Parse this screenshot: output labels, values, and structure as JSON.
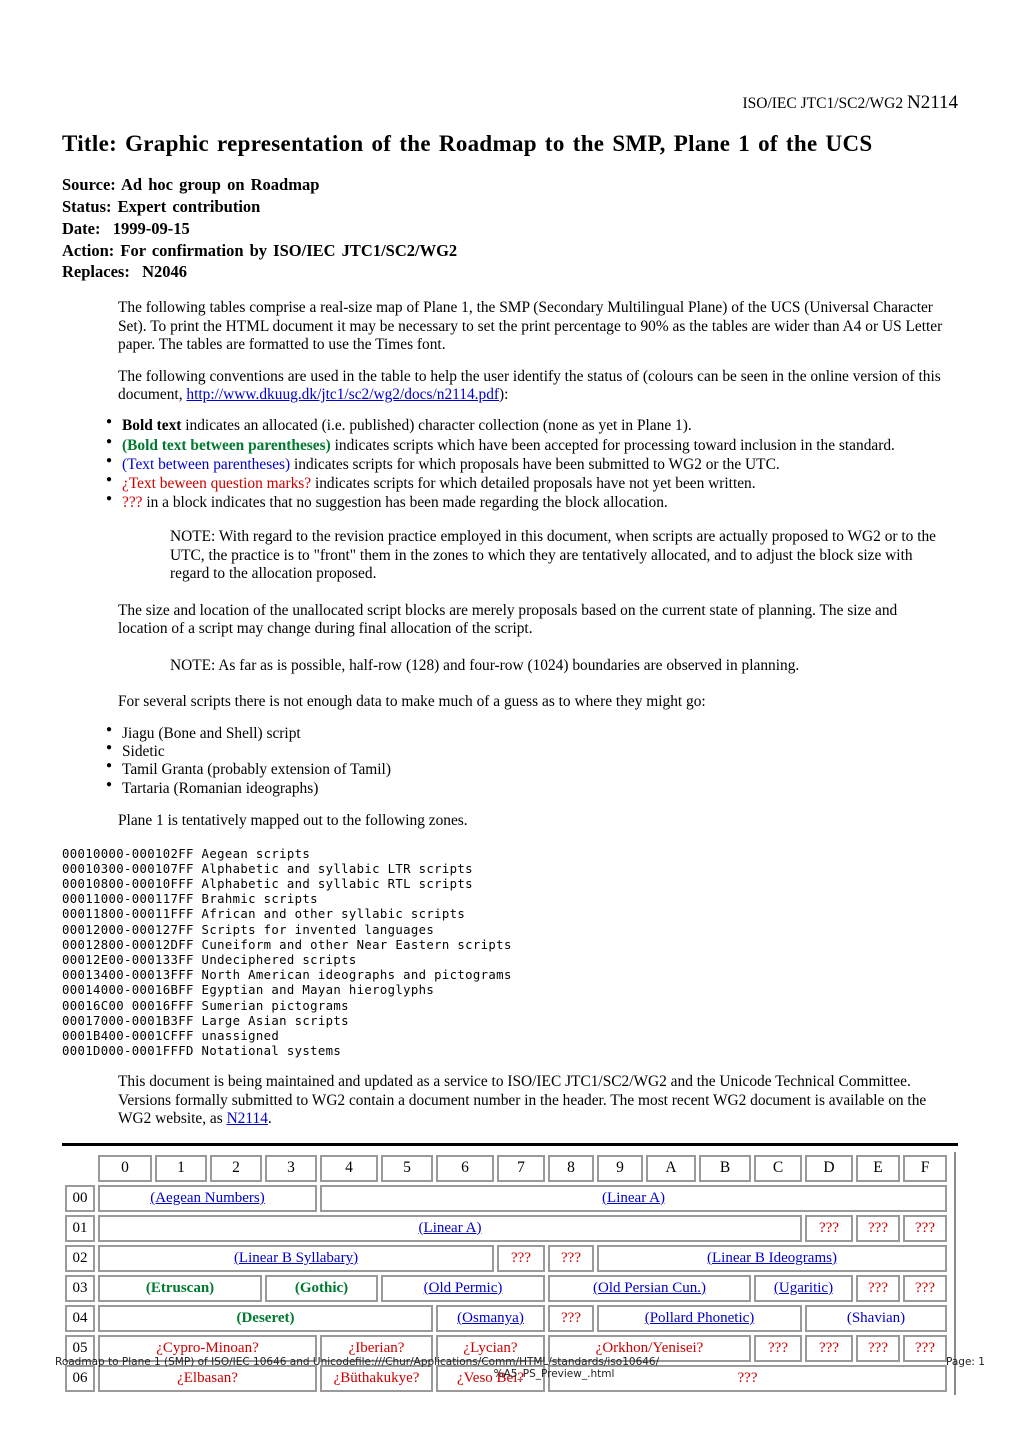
{
  "header": {
    "prefix": "ISO/IEC JTC1/SC2/WG2 ",
    "number": "N2114"
  },
  "title": "Title: Graphic representation of the Roadmap to the SMP, Plane 1 of the UCS",
  "meta": {
    "source": "Source: Ad hoc group on Roadmap",
    "status": "Status: Expert contribution",
    "date": "Date:  1999-09-15",
    "action": "Action: For confirmation by ISO/IEC JTC1/SC2/WG2",
    "replaces": "Replaces:  N2046"
  },
  "paragraphs": {
    "intro": "The following tables comprise a real-size map of Plane 1, the SMP (Secondary Multilingual Plane) of the UCS (Universal Character Set). To print the HTML document it may be necessary to set the print percentage to 90% as the tables are wider than A4 or US Letter paper. The tables are formatted to use the Times font.",
    "conventions_lead_1": "The following conventions are used in the table to help the user identify the status of (colours can be seen in the online version of this document, ",
    "conventions_link": "http://www.dkuug.dk/jtc1/sc2/wg2/docs/n2114.pdf",
    "conventions_lead_2": "):",
    "note_revision": "NOTE: With regard to the revision practice employed in this document, when scripts are actually proposed to WG2 or to the UTC, the practice is to \"front\" them in the zones to which they are tentatively allocated, and to adjust the block size with regard to the allocation proposed.",
    "size_location": "The size and location of the unallocated script blocks are merely proposals based on the current state of planning. The size and location of a script may change during final allocation of the script.",
    "note_boundaries": "NOTE: As far as is possible, half-row (128) and four-row (1024) boundaries are observed in planning.",
    "several_scripts": "For several scripts there is not enough data to make much of a guess as to where they might go:",
    "plane_zones_lead": "Plane 1 is tentatively mapped out to the following zones.",
    "maintained_1": "This document is being maintained and updated as a service to ISO/IEC JTC1/SC2/WG2 and the Unicode Technical Committee. Versions formally submitted to WG2 contain a document number in the header. The most recent WG2 document is available on the WG2 website, as ",
    "maintained_link": "N2114",
    "maintained_2": "."
  },
  "conventions": [
    {
      "marker": "Bold text",
      "marker_style": "bold",
      "text": " indicates an allocated (i.e. published) character collection (none as yet in Plane 1)."
    },
    {
      "marker": "(Bold text between parentheses)",
      "marker_style": "green",
      "text": " indicates scripts which have been accepted for processing toward inclusion in the standard."
    },
    {
      "marker": "(Text between parentheses)",
      "marker_style": "blue",
      "text": " indicates scripts for which proposals have been submitted to WG2 or the UTC."
    },
    {
      "marker": "¿Text beween question marks?",
      "marker_style": "red",
      "text": " indicates scripts for which detailed proposals have not yet been written."
    },
    {
      "marker": "???",
      "marker_style": "red",
      "text": " in a block indicates that no suggestion has been made regarding the block allocation."
    }
  ],
  "unplaced_scripts": [
    "Jiagu (Bone and Shell) script",
    "Sidetic",
    "Tamil Granta (probably extension of Tamil)",
    "Tartaria (Romanian ideographs)"
  ],
  "zones_block": "00010000-000102FF Aegean scripts\n00010300-000107FF Alphabetic and syllabic LTR scripts\n00010800-00010FFF Alphabetic and syllabic RTL scripts\n00011000-000117FF Brahmic scripts\n00011800-00011FFF African and other syllabic scripts\n00012000-000127FF Scripts for invented languages\n00012800-00012DFF Cuneiform and other Near Eastern scripts\n00012E00-000133FF Undeciphered scripts\n00013400-00013FFF North American ideographs and pictograms\n00014000-00016BFF Egyptian and Mayan hieroglyphs\n00016C00 00016FFF Sumerian pictograms\n00017000-0001B3FF Large Asian scripts\n0001B400-0001CFFF unassigned\n0001D000-0001FFFD Notational systems",
  "roadmap_table": {
    "columns": [
      "0",
      "1",
      "2",
      "3",
      "4",
      "5",
      "6",
      "7",
      "8",
      "9",
      "A",
      "B",
      "C",
      "D",
      "E",
      "F"
    ],
    "rows": [
      {
        "label": "00",
        "cells": [
          {
            "text": "(Aegean Numbers)",
            "style": "blue",
            "span": 4
          },
          {
            "text": "(Linear A)",
            "style": "blue",
            "span": 12
          }
        ]
      },
      {
        "label": "01",
        "cells": [
          {
            "text": "(Linear A)",
            "style": "blue",
            "span": 13
          },
          {
            "text": "???",
            "style": "red",
            "span": 1
          },
          {
            "text": "???",
            "style": "red",
            "span": 1
          },
          {
            "text": "???",
            "style": "red",
            "span": 1
          }
        ]
      },
      {
        "label": "02",
        "cells": [
          {
            "text": "(Linear B Syllabary)",
            "style": "blue",
            "span": 7
          },
          {
            "text": "???",
            "style": "red",
            "span": 1
          },
          {
            "text": "???",
            "style": "red",
            "span": 1
          },
          {
            "text": "(Linear B Ideograms)",
            "style": "blue",
            "span": 7
          }
        ]
      },
      {
        "label": "03",
        "cells": [
          {
            "text": "(Etruscan)",
            "style": "green",
            "span": 3
          },
          {
            "text": "(Gothic)",
            "style": "green",
            "span": 2
          },
          {
            "text": "(Old Permic)",
            "style": "blue",
            "span": 3
          },
          {
            "text": "(Old Persian Cun.)",
            "style": "blue",
            "span": 4
          },
          {
            "text": "(Ugaritic)",
            "style": "blue",
            "span": 2
          },
          {
            "text": "???",
            "style": "red",
            "span": 1
          },
          {
            "text": "???",
            "style": "red",
            "span": 1
          }
        ]
      },
      {
        "label": "04",
        "cells": [
          {
            "text": "(Deseret)",
            "style": "green",
            "span": 6
          },
          {
            "text": "(Osmanya)",
            "style": "blue",
            "span": 2
          },
          {
            "text": "???",
            "style": "red",
            "span": 1
          },
          {
            "text": "(Pollard Phonetic)",
            "style": "blue",
            "span": 4
          },
          {
            "text": "(Shavian)",
            "style": "blue-nounderline",
            "span": 3
          }
        ]
      },
      {
        "label": "05",
        "cells": [
          {
            "text": "¿Cypro-Minoan?",
            "style": "red",
            "span": 4
          },
          {
            "text": "¿Iberian?",
            "style": "red",
            "span": 2
          },
          {
            "text": "¿Lycian?",
            "style": "red",
            "span": 2
          },
          {
            "text": "¿Orkhon/Yenisei?",
            "style": "red",
            "span": 4
          },
          {
            "text": "???",
            "style": "red",
            "span": 1
          },
          {
            "text": "???",
            "style": "red",
            "span": 1
          },
          {
            "text": "???",
            "style": "red",
            "span": 1
          },
          {
            "text": "???",
            "style": "red",
            "span": 1
          }
        ]
      },
      {
        "label": "06",
        "cells": [
          {
            "text": "¿Elbasan?",
            "style": "red",
            "span": 4
          },
          {
            "text": "¿Büthakukye?",
            "style": "red",
            "span": 2
          },
          {
            "text": "¿Veso Bei?",
            "style": "red",
            "span": 2
          },
          {
            "text": "???",
            "style": "red",
            "span": 8
          }
        ]
      }
    ]
  },
  "footer": {
    "left": "Roadmap to Plane 1 (SMP) of ISO/IEC 10646 and Unicode",
    "center_line1": "file:///Chur/Applications/Comm/HTML/standards/iso10646/",
    "center_line2": "%A5_PS_Preview_.html",
    "right": "Page: 1"
  },
  "colors": {
    "blue": "#0000cc",
    "green": "#007a2f",
    "red": "#cc0000"
  }
}
